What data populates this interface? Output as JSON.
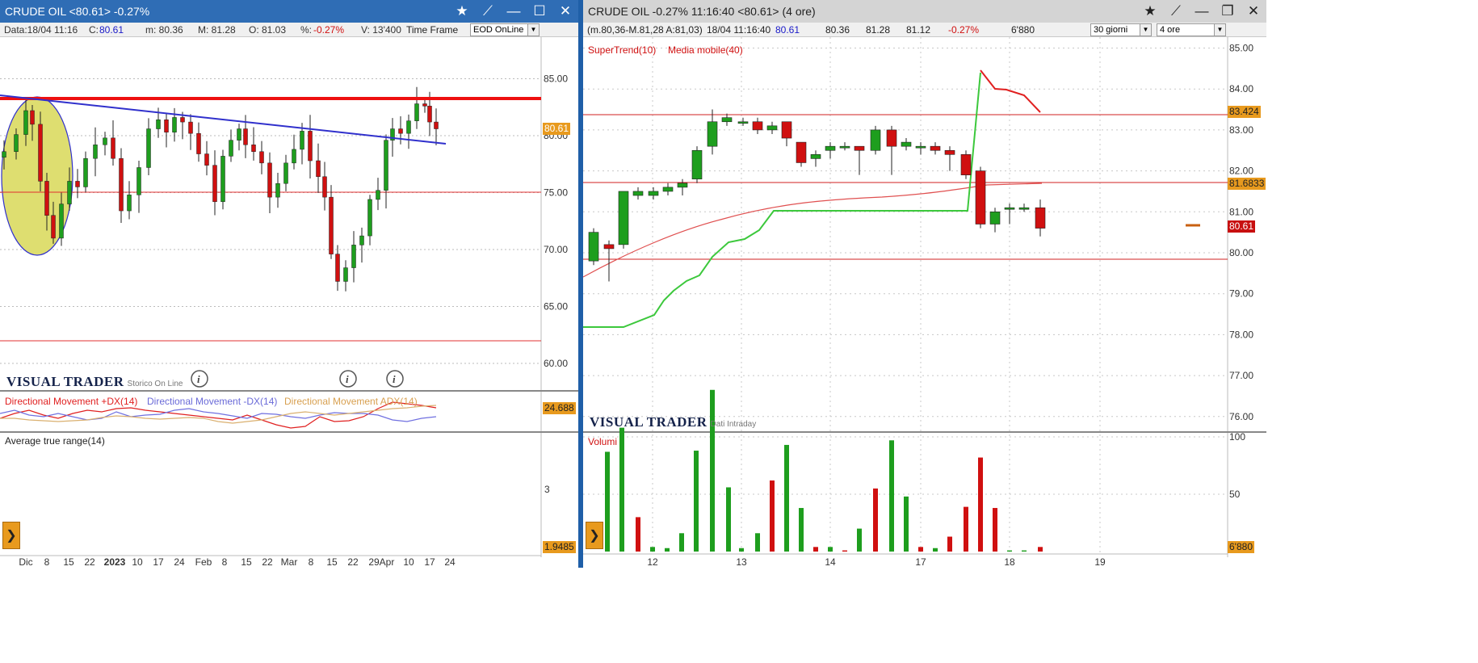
{
  "left": {
    "title": "CRUDE OIL <80.61> -0.27%",
    "info": {
      "data": "Data:18/04 11:16",
      "c_label": "C:",
      "c_value": "80.61",
      "m": "m: 80.36",
      "M": "M: 81.28",
      "O": "O: 81.03",
      "pct_label": "%:",
      "pct_value": "-0.27%",
      "v": "V: 13'400",
      "timeframe_label": "Time Frame",
      "timeframe_value": "EOD OnLine"
    },
    "price_ticks": [
      "85.00",
      "80.00",
      "75.00",
      "70.00",
      "65.00",
      "60.00"
    ],
    "price_tag": "80.61",
    "brand": "VISUAL TRADER",
    "brand_sub": "Storico On Line",
    "dmi_labels": [
      "Directional Movement +DX(14)",
      "Directional Movement -DX(14)",
      "Directional Movement ADX(14)"
    ],
    "dmi_tag": "24.688",
    "atr_label": "Average true range(14)",
    "atr_tick": "3",
    "atr_tag": "1.9485",
    "x_ticks": [
      "Dic",
      "8",
      "15",
      "22",
      "2023",
      "10",
      "17",
      "24",
      "Feb",
      "8",
      "15",
      "22",
      "Mar",
      "8",
      "15",
      "22",
      "29",
      "Apr",
      "10",
      "17",
      "24"
    ],
    "colors": {
      "up": "#1e9e1e",
      "down": "#d01010",
      "trendline": "#3030cc",
      "resistance": "#ee1010",
      "ellipse": "#dede70"
    }
  },
  "right": {
    "title": "CRUDE OIL -0.27% 11:16:40  <80.61> (4 ore)",
    "info": {
      "range": "(m.80,36-M.81,28 A:81,03)",
      "datetime": "18/04 11:16:40",
      "last": "80.61",
      "low": "80.36",
      "high": "81.28",
      "v4": "81.12",
      "pct": "-0.27%",
      "vol": "6'880",
      "period": "30 giorni",
      "interval": "4 ore"
    },
    "legend": [
      "SuperTrend(10)",
      "Media mobile(40)"
    ],
    "price_ticks": [
      "85.00",
      "84.00",
      "83.00",
      "82.00",
      "81.00",
      "80.00",
      "79.00",
      "78.00",
      "77.00",
      "76.00"
    ],
    "tags": {
      "r1": "83.424",
      "r2": "81.6833",
      "last": "80.61"
    },
    "brand": "VISUAL TRADER",
    "brand_sub": "Dati Intraday",
    "volume_label": "Volumi",
    "volume_ticks": [
      "100",
      "50"
    ],
    "volume_tag": "6'880",
    "x_ticks": [
      "12",
      "13",
      "14",
      "17",
      "18",
      "19"
    ]
  }
}
